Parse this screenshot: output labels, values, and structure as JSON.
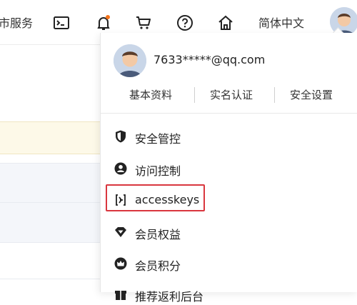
{
  "topbar": {
    "service_text": "市服务",
    "language": "简体中文",
    "icons": [
      "terminal-icon",
      "bell-icon",
      "cart-icon",
      "help-icon",
      "home-icon"
    ],
    "notification_dot_color": "#f5731a"
  },
  "account": {
    "email": "7633*****@qq.com",
    "links": [
      "基本资料",
      "实名认证",
      "安全设置"
    ]
  },
  "menu": {
    "items": [
      {
        "label": "安全管控",
        "icon": "shield-icon"
      },
      {
        "label": "访问控制",
        "icon": "user-circle-icon"
      },
      {
        "label": "accesskeys",
        "icon": "key-bracket-icon",
        "highlighted": true
      },
      {
        "label": "会员权益",
        "icon": "diamond-icon"
      },
      {
        "label": "会员积分",
        "icon": "crown-icon"
      },
      {
        "label": "推荐返利后台",
        "icon": "gift-icon"
      }
    ]
  },
  "colors": {
    "highlight_border": "#d9363e",
    "background_stripe": "#fdf9e8"
  }
}
